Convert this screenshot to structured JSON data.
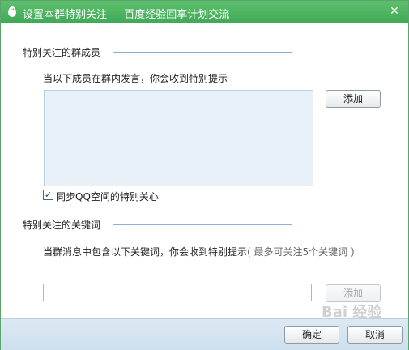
{
  "window": {
    "title": "设置本群特别关注 — 百度经验回享计划交流",
    "minimize_glyph": "—",
    "close_glyph": "✕"
  },
  "members_section": {
    "heading": "特别关注的群成员",
    "hint": "当以下成员在群内发言，你会收到特别提示",
    "add_button": "添加"
  },
  "sync_checkbox": {
    "label": "同步QQ空间的特别关心",
    "checked": true
  },
  "keywords_section": {
    "heading": "特别关注的关键词",
    "hint": "当群消息中包含以下关键词，你会收到特别提示",
    "hint_note": "( 最多可关注5个关键词 )",
    "input_value": "",
    "add_button": "添加"
  },
  "footer": {
    "ok_button": "确定",
    "cancel_button": "取消"
  },
  "watermark": {
    "text": "Bai 经验"
  },
  "colors": {
    "titlebar": "#4cb561",
    "members_box": "#e8f1f8",
    "footer": "#d6e6f1"
  }
}
